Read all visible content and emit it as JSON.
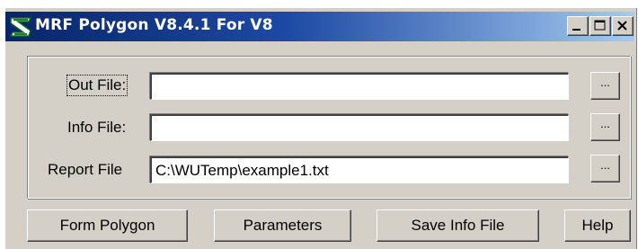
{
  "window": {
    "title": "MRF Polygon V8.4.1 For V8",
    "title_gradient": [
      "#0a246a",
      "#a6caf0"
    ],
    "app_icon": "app-logo-icon",
    "controls": [
      "minimize-icon",
      "maximize-icon",
      "close-icon"
    ]
  },
  "form": {
    "out_file": {
      "label": "Out File:",
      "value": ""
    },
    "info_file": {
      "label": "Info File:",
      "value": ""
    },
    "report_file": {
      "label": "Report File",
      "value": "C:\\WUTemp\\example1.txt"
    },
    "browse_label": "..."
  },
  "actions": {
    "form_polygon": "Form Polygon",
    "parameters": "Parameters",
    "save_info_file": "Save Info File",
    "help": "Help"
  }
}
